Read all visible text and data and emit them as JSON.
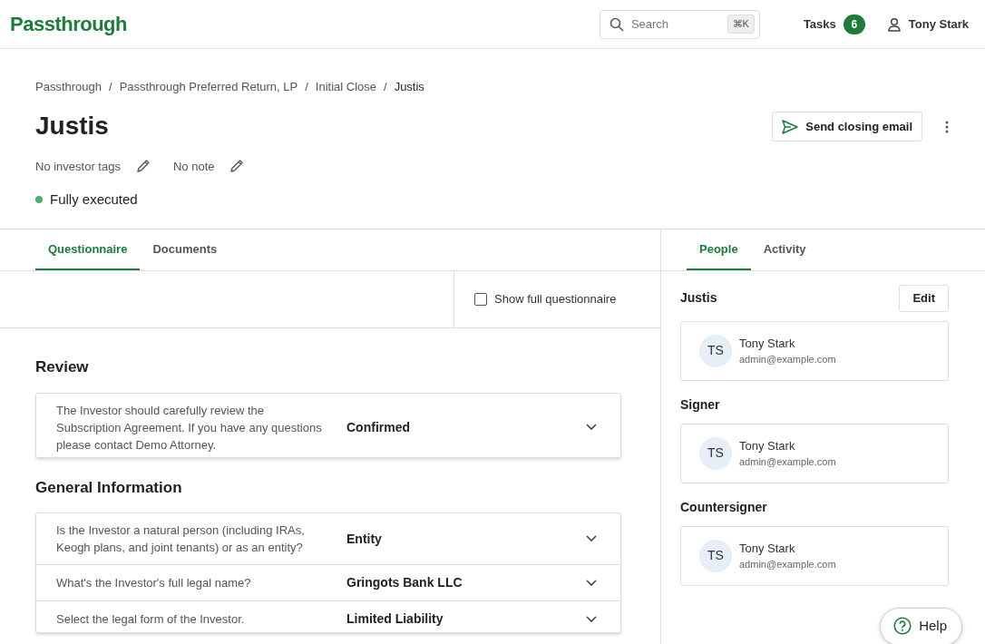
{
  "header": {
    "logo": "Passthrough",
    "search": {
      "placeholder": "Search",
      "shortcut": "⌘K"
    },
    "tasks": {
      "label": "Tasks",
      "count": "6"
    },
    "user": "Tony Stark"
  },
  "breadcrumbs": [
    "Passthrough",
    "Passthrough Preferred Return, LP",
    "Initial Close",
    "Justis"
  ],
  "breadcrumb_separators": [
    "/",
    "/",
    "/"
  ],
  "title": "Justis",
  "send_button": "Send closing email",
  "tags": "No investor tags",
  "note": "No note",
  "status": {
    "text": "Fully executed",
    "color": "#4caf6e"
  },
  "left_tabs": [
    {
      "label": "Questionnaire",
      "selected": true
    },
    {
      "label": "Documents",
      "selected": false
    }
  ],
  "show_full": {
    "label": "Show full questionnaire",
    "checked": false
  },
  "sections": [
    {
      "title": "Review",
      "rows": [
        {
          "question": "The Investor should carefully review the Subscription Agreement. If you have any questions please contact Demo Attorney.",
          "answer": "Confirmed"
        }
      ]
    },
    {
      "title": "General Information",
      "rows": [
        {
          "question": "Is the Investor a natural person (including IRAs, Keogh plans, and joint tenants) or as an entity?",
          "answer": "Entity"
        },
        {
          "question": "What's the Investor's full legal name?",
          "answer": "Gringots Bank LLC"
        },
        {
          "question": "Select the legal form of the Investor.",
          "answer": "Limited Liability"
        }
      ]
    }
  ],
  "right_tabs": [
    {
      "label": "People",
      "selected": true
    },
    {
      "label": "Activity",
      "selected": false
    }
  ],
  "groups": [
    {
      "title": "Justis",
      "action": "Edit",
      "people": [
        {
          "initials": "TS",
          "name": "Tony Stark",
          "email": "admin@example.com"
        }
      ]
    },
    {
      "title": "Signer",
      "people": [
        {
          "initials": "TS",
          "name": "Tony Stark",
          "email": "admin@example.com"
        }
      ]
    },
    {
      "title": "Countersigner",
      "people": [
        {
          "initials": "TS",
          "name": "Tony Stark",
          "email": "admin@example.com"
        }
      ]
    }
  ],
  "help": "Help"
}
